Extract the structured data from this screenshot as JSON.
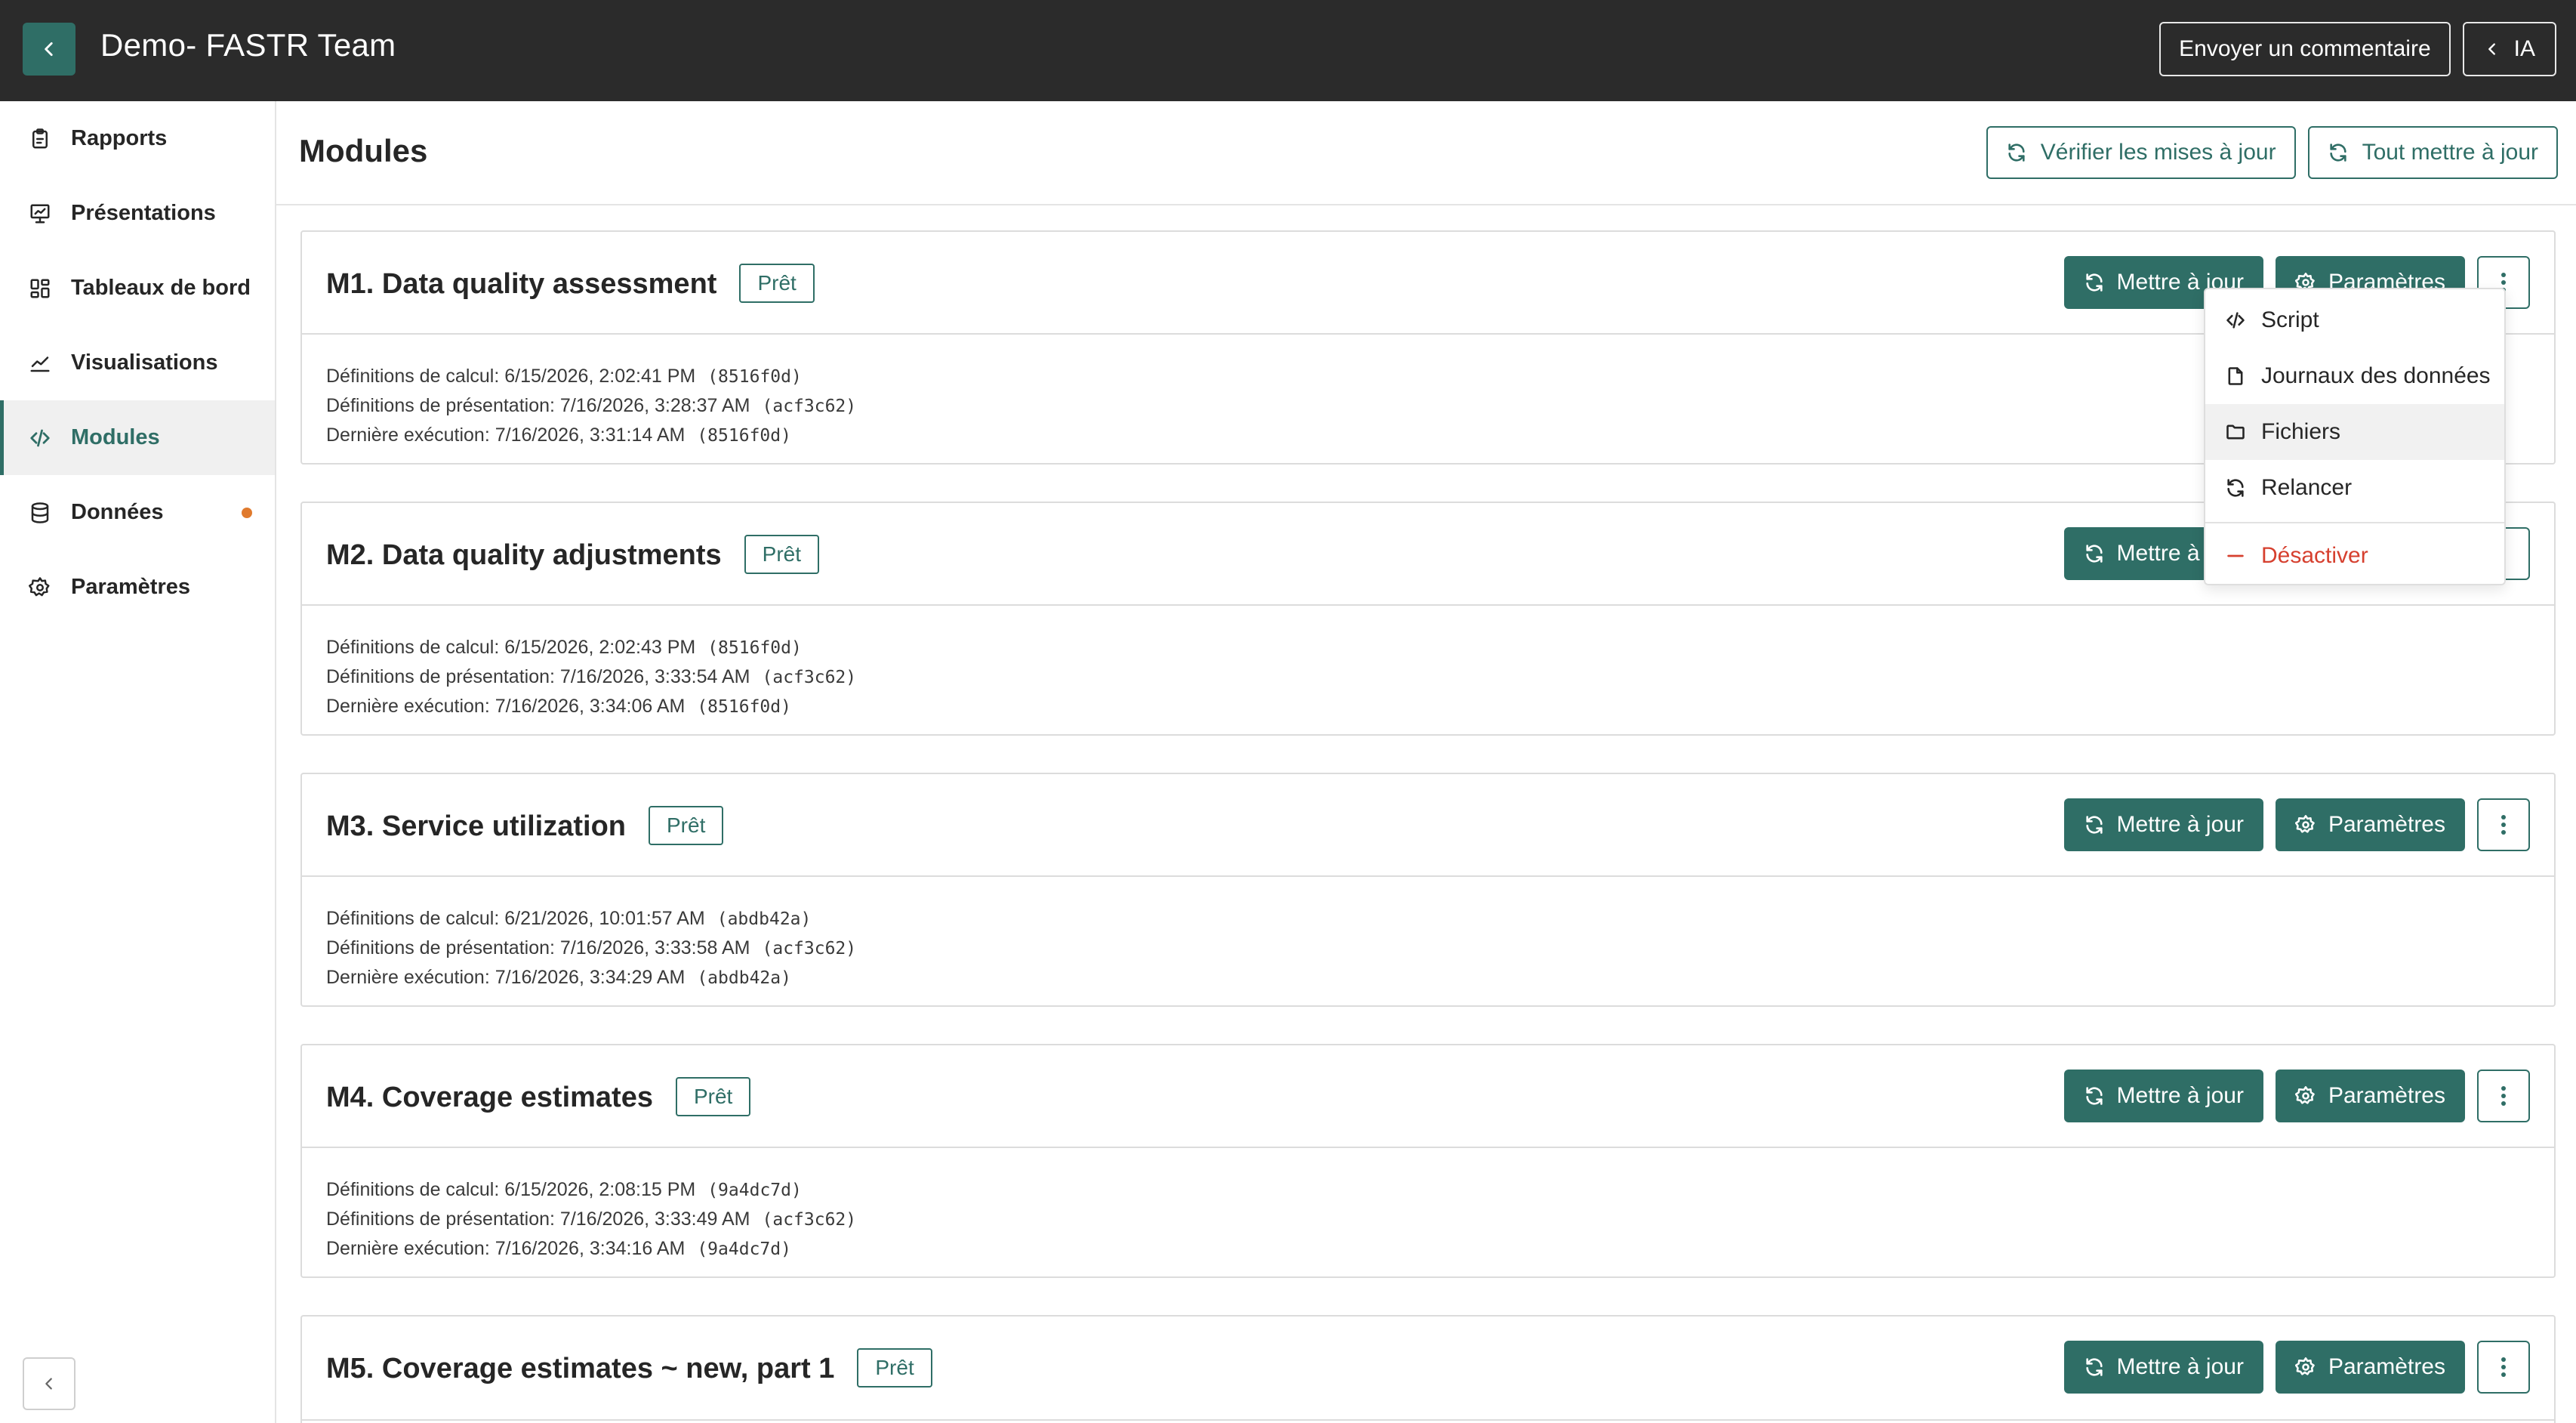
{
  "header": {
    "title": "Demo- FASTR Team",
    "feedback_label": "Envoyer un commentaire",
    "ai_label": "IA"
  },
  "sidebar": {
    "items": [
      {
        "label": "Rapports",
        "icon": "clipboard-icon"
      },
      {
        "label": "Présentations",
        "icon": "presentation-icon"
      },
      {
        "label": "Tableaux de bord",
        "icon": "dashboard-grid-icon"
      },
      {
        "label": "Visualisations",
        "icon": "line-chart-icon"
      },
      {
        "label": "Modules",
        "icon": "code-icon",
        "active": true
      },
      {
        "label": "Données",
        "icon": "database-icon",
        "has_dot": true
      },
      {
        "label": "Paramètres",
        "icon": "gear-icon"
      }
    ]
  },
  "main": {
    "title": "Modules",
    "check_updates_label": "Vérifier les mises à jour",
    "update_all_label": "Tout mettre à jour"
  },
  "module_actions": {
    "update_label": "Mettre à jour",
    "settings_label": "Paramètres"
  },
  "modules": [
    {
      "title": "M1. Data quality assessment",
      "status": "Prêt",
      "calc": "Définitions de calcul: 6/15/2026, 2:02:41 PM",
      "calc_hash": "(8516f0d)",
      "pres": "Définitions de présentation: 7/16/2026, 3:28:37 AM",
      "pres_hash": "(acf3c62)",
      "run": "Dernière exécution: 7/16/2026, 3:31:14 AM",
      "run_hash": "(8516f0d)"
    },
    {
      "title": "M2. Data quality adjustments",
      "status": "Prêt",
      "calc": "Définitions de calcul: 6/15/2026, 2:02:43 PM",
      "calc_hash": "(8516f0d)",
      "pres": "Définitions de présentation: 7/16/2026, 3:33:54 AM",
      "pres_hash": "(acf3c62)",
      "run": "Dernière exécution: 7/16/2026, 3:34:06 AM",
      "run_hash": "(8516f0d)"
    },
    {
      "title": "M3. Service utilization",
      "status": "Prêt",
      "calc": "Définitions de calcul: 6/21/2026, 10:01:57 AM",
      "calc_hash": "(abdb42a)",
      "pres": "Définitions de présentation: 7/16/2026, 3:33:58 AM",
      "pres_hash": "(acf3c62)",
      "run": "Dernière exécution: 7/16/2026, 3:34:29 AM",
      "run_hash": "(abdb42a)"
    },
    {
      "title": "M4. Coverage estimates",
      "status": "Prêt",
      "calc": "Définitions de calcul: 6/15/2026, 2:08:15 PM",
      "calc_hash": "(9a4dc7d)",
      "pres": "Définitions de présentation: 7/16/2026, 3:33:49 AM",
      "pres_hash": "(acf3c62)",
      "run": "Dernière exécution: 7/16/2026, 3:34:16 AM",
      "run_hash": "(9a4dc7d)"
    },
    {
      "title": "M5. Coverage estimates ~ new, part 1",
      "status": "Prêt"
    }
  ],
  "dropdown": {
    "items": [
      {
        "label": "Script",
        "icon": "code-icon"
      },
      {
        "label": "Journaux des données",
        "icon": "file-icon"
      },
      {
        "label": "Fichiers",
        "icon": "folder-icon",
        "hover": true
      },
      {
        "label": "Relancer",
        "icon": "refresh-icon"
      },
      {
        "label": "Désactiver",
        "icon": "minus-icon",
        "danger": true
      }
    ]
  },
  "colors": {
    "accent": "#2f6e66",
    "topbar": "#2b2b2b",
    "danger": "#d6402f",
    "notification": "#e07a2d"
  }
}
